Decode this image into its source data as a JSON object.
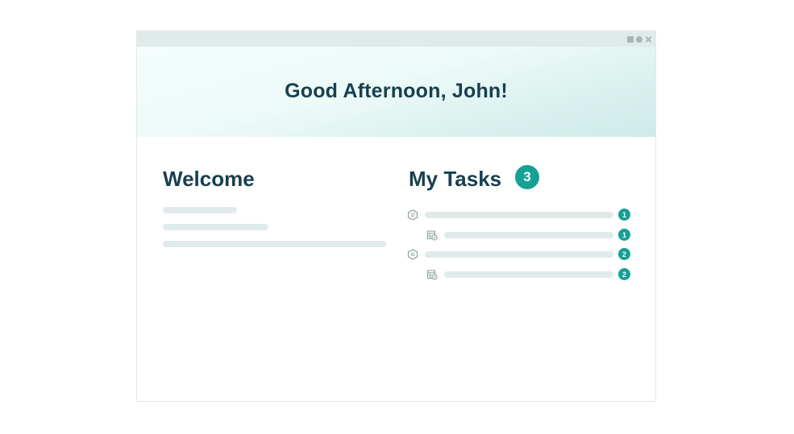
{
  "header": {
    "greeting": "Good Afternoon, John!"
  },
  "window_controls": {
    "icons": [
      "minimize-icon",
      "maximize-icon",
      "close-icon"
    ]
  },
  "welcome": {
    "title": "Welcome"
  },
  "tasks": {
    "title": "My Tasks",
    "count": "3",
    "items": [
      {
        "icon": "document-icon",
        "count": "1"
      },
      {
        "icon": "calendar-check-icon",
        "count": "1"
      },
      {
        "icon": "document-icon",
        "count": "2"
      },
      {
        "icon": "calendar-check-icon",
        "count": "2"
      }
    ]
  },
  "colors": {
    "heading": "#173f4f",
    "accent": "#15a193",
    "placeholder": "#e1eaea",
    "titlebar": "#e1eaea"
  }
}
